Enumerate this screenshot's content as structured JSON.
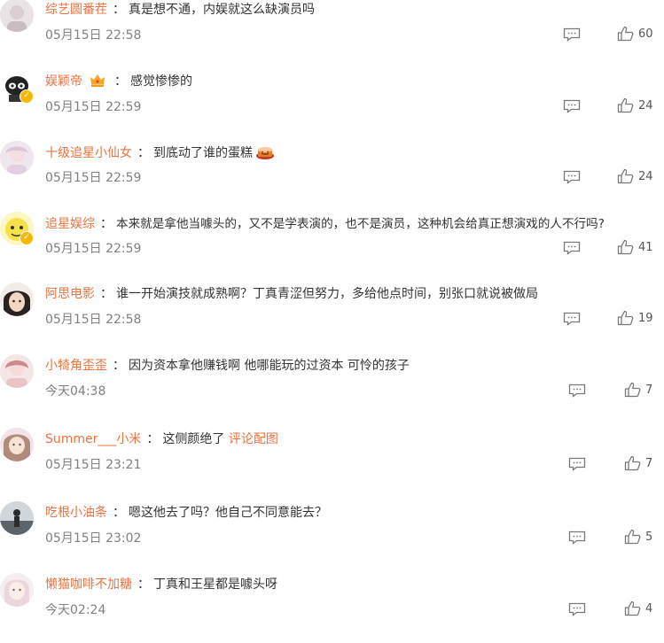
{
  "comments": [
    {
      "user": "综艺圆番茬",
      "text": "真是想不通，内娱就这么缺演员吗",
      "time": "05月15日 22:58",
      "likes": "60"
    },
    {
      "user": "娱颖帝",
      "text": "感觉惨惨的",
      "time": "05月15日 22:59",
      "likes": "24"
    },
    {
      "user": "十级追星小仙女",
      "text": "到底动了谁的蛋糕",
      "time": "05月15日 22:59",
      "likes": "24"
    },
    {
      "user": "追星娱综",
      "text": "本来就是拿他当噱头的，又不是学表演的，也不是演员，这种机会给真正想演戏的人不行吗?",
      "time": "05月15日 22:59",
      "likes": "41"
    },
    {
      "user": "阿思电影",
      "text": "谁一开始演技就成熟啊？丁真青涩但努力，多给他点时间，别张口就说被做局",
      "time": "05月15日 22:58",
      "likes": "19"
    },
    {
      "user": "小犄角歪歪",
      "text": "因为资本拿他赚钱啊 他哪能玩的过资本 可怜的孩子",
      "time": "今天04:38",
      "likes": "7"
    },
    {
      "user": "Summer___小米",
      "text": "这侧颜绝了",
      "link": "评论配图",
      "time": "05月15日 23:21",
      "likes": "7"
    },
    {
      "user": "吃根小油条",
      "text": "嗯这他去了吗？他自己不同意能去？",
      "time": "05月15日 23:02",
      "likes": "5"
    },
    {
      "user": "懒猫咖啡不加糖",
      "text": "丁真和王星都是噱头呀",
      "time": "今天02:24",
      "likes": "4"
    }
  ],
  "colon": "："
}
